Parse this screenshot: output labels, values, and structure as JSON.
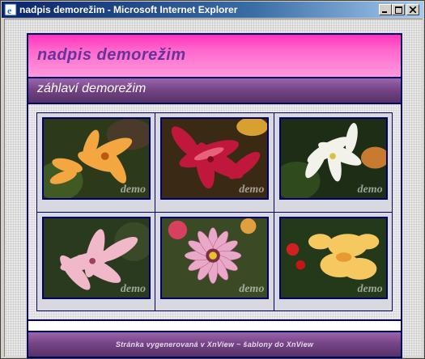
{
  "window": {
    "title": "nadpis demorežim - Microsoft Internet Explorer",
    "icon": "ie-icon",
    "buttons": [
      "minimize-icon",
      "maximize-icon",
      "close-icon"
    ]
  },
  "page": {
    "header_title": "nadpis demorežim",
    "subheader": "záhlaví demorežim",
    "footer": "Stránka vygenerovaná v XnView  ~  šablony do XnView",
    "colors": {
      "header_pink": "#ff66cc",
      "header_purple": "#774488",
      "frame": "#000066"
    }
  },
  "gallery": {
    "watermark": "demo",
    "thumbs": [
      {
        "name": "orange-lily-thumbnail"
      },
      {
        "name": "red-lily-thumbnail"
      },
      {
        "name": "white-lily-thumbnail"
      },
      {
        "name": "pink-lily-thumbnail"
      },
      {
        "name": "gazania-thumbnail"
      },
      {
        "name": "yellow-flowers-thumbnail"
      }
    ]
  }
}
